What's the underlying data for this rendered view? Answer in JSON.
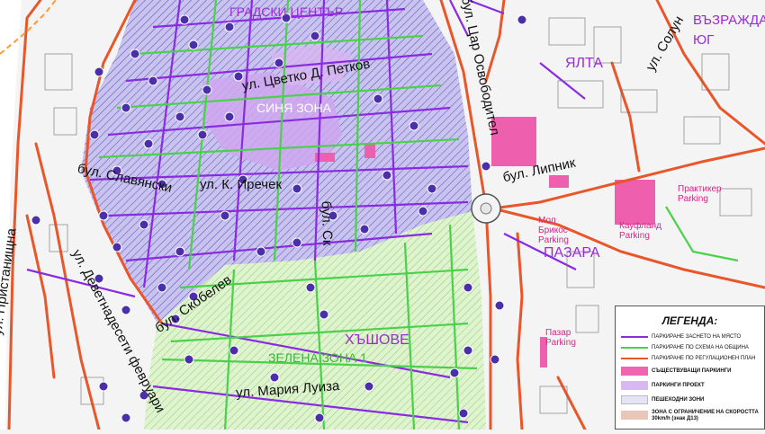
{
  "map": {
    "streets": [
      {
        "id": "pristanishtna",
        "text": "ул. Пристанищна"
      },
      {
        "id": "devetnadeseti",
        "text": "ул. Деветнадесети февруари"
      },
      {
        "id": "slavyanski",
        "text": "бул. Славянски"
      },
      {
        "id": "irechek",
        "text": "ул. К. Иречек"
      },
      {
        "id": "petkov",
        "text": "ул. Цветко Д. Петков"
      },
      {
        "id": "tsar",
        "text": "бул. Цар Освободител"
      },
      {
        "id": "lipnik",
        "text": "бул. Липник"
      },
      {
        "id": "solun",
        "text": "ул. Солун"
      },
      {
        "id": "skobelev",
        "text": "бул. Скобелев"
      },
      {
        "id": "marija_luiza",
        "text": "ул. Мария Луиза"
      },
      {
        "id": "bor",
        "text": "бул. Ск"
      }
    ],
    "districts": [
      {
        "id": "vazrazhdane_yug",
        "text": "ВЪЗРАЖДАНЕ ЮГ"
      },
      {
        "id": "yalta",
        "text": "ЯЛТА"
      },
      {
        "id": "pazara",
        "text": "ПАЗАРА"
      },
      {
        "id": "hashove",
        "text": "ХЪШОВЕ"
      },
      {
        "id": "tsentar",
        "text": "ГРАДСКИ ЦЕНТЪР"
      }
    ],
    "zones": [
      {
        "id": "sinya",
        "text": "СИНЯ ЗОНА"
      },
      {
        "id": "zelena",
        "text": "ЗЕЛЕНА ЗОНА 1"
      }
    ],
    "parkings": [
      {
        "id": "praktiker",
        "text": "Практикер Parking"
      },
      {
        "id": "kaufland",
        "text": "Кауфланд Parking"
      },
      {
        "id": "mol",
        "text": "Мол Брикос Parking"
      },
      {
        "id": "pazar",
        "text": "Пазар Parking"
      }
    ]
  },
  "legend": {
    "title": "ЛЕГЕНДА:",
    "items": [
      {
        "label": "ПАРКИРАНЕ ЗАСНЕТО НА МЯСТО",
        "color": "#8a2be2"
      },
      {
        "label": "ПАРКИРАНЕ ПО СХЕМА НА ОБЩИНА",
        "color": "#4ad14a"
      },
      {
        "label": "ПАРКИРАНЕ ПО РЕГУЛАЦИОНЕН ПЛАН",
        "color": "#e8562a"
      },
      {
        "label": "СЪЩЕСТВУВАЩИ ПАРКИНГИ",
        "color": "#ee66b0"
      },
      {
        "label": "ПАРКИНГИ ПРОЕКТ",
        "color": "#d7b8f0"
      },
      {
        "label": "ПЕШЕХОДНИ ЗОНИ",
        "color": "#e6e3f7"
      },
      {
        "label": "ЗОНА С ОГРАНИЧЕНИЕ НА СКОРОСТТА 30km/h (знак Д13)",
        "color": "#e9c6b8"
      }
    ]
  }
}
